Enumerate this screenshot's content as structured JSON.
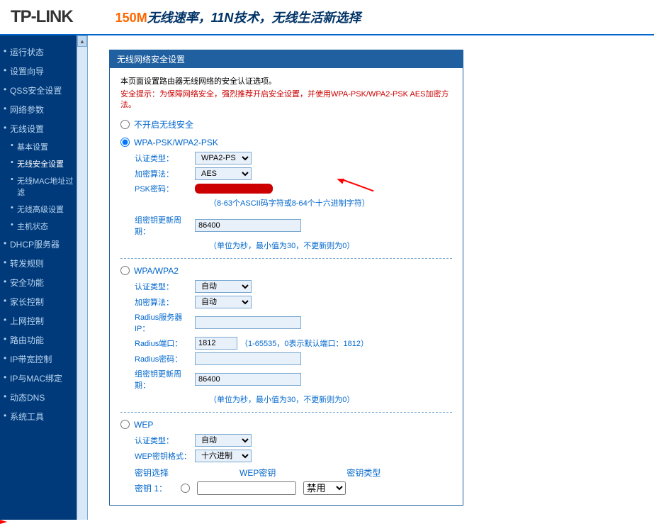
{
  "header": {
    "logo": "TP-LINK",
    "tag_orange": "150M",
    "tag_rest": "无线速率，11N技术，无线生活新选择"
  },
  "sidebar": {
    "items": [
      "运行状态",
      "设置向导",
      "QSS安全设置",
      "网络参数",
      "无线设置",
      "DHCP服务器",
      "转发规则",
      "安全功能",
      "家长控制",
      "上网控制",
      "路由功能",
      "IP带宽控制",
      "IP与MAC绑定",
      "动态DNS",
      "系统工具"
    ],
    "subs": [
      "基本设置",
      "无线安全设置",
      "无线MAC地址过滤",
      "无线高级设置",
      "主机状态"
    ]
  },
  "panel": {
    "title": "无线网络安全设置",
    "desc": "本页面设置路由器无线网络的安全认证选项。",
    "warn": "安全提示：为保障网络安全，强烈推荐开启安全设置，并使用WPA-PSK/WPA2-PSK AES加密方法。",
    "opt_disable": "不开启无线安全",
    "opt_wpapsk": "WPA-PSK/WPA2-PSK",
    "opt_wpa": "WPA/WPA2",
    "opt_wep": "WEP",
    "lbl_auth": "认证类型：",
    "lbl_cipher": "加密算法：",
    "lbl_psk": "PSK密码：",
    "lbl_group": "组密钥更新周期：",
    "lbl_radius_ip": "Radius服务器IP：",
    "lbl_radius_port": "Radius端口：",
    "lbl_radius_pw": "Radius密码：",
    "lbl_wepfmt": "WEP密钥格式：",
    "lbl_keysel": "密钥选择",
    "lbl_wepkey": "WEP密钥",
    "lbl_keytype": "密钥类型",
    "lbl_key1": "密钥 1：",
    "val_wpa2ps": "WPA2-PS",
    "val_aes": "AES",
    "val_auto": "自动",
    "val_hex": "十六进制",
    "val_disable": "禁用",
    "val_1812": "1812",
    "val_86400": "86400",
    "hint_psk": "（8-63个ASCII码字符或8-64个十六进制字符）",
    "hint_group": "（单位为秒，最小值为30，不更新则为0）",
    "hint_port": "（1-65535，0表示默认端口：1812）"
  }
}
